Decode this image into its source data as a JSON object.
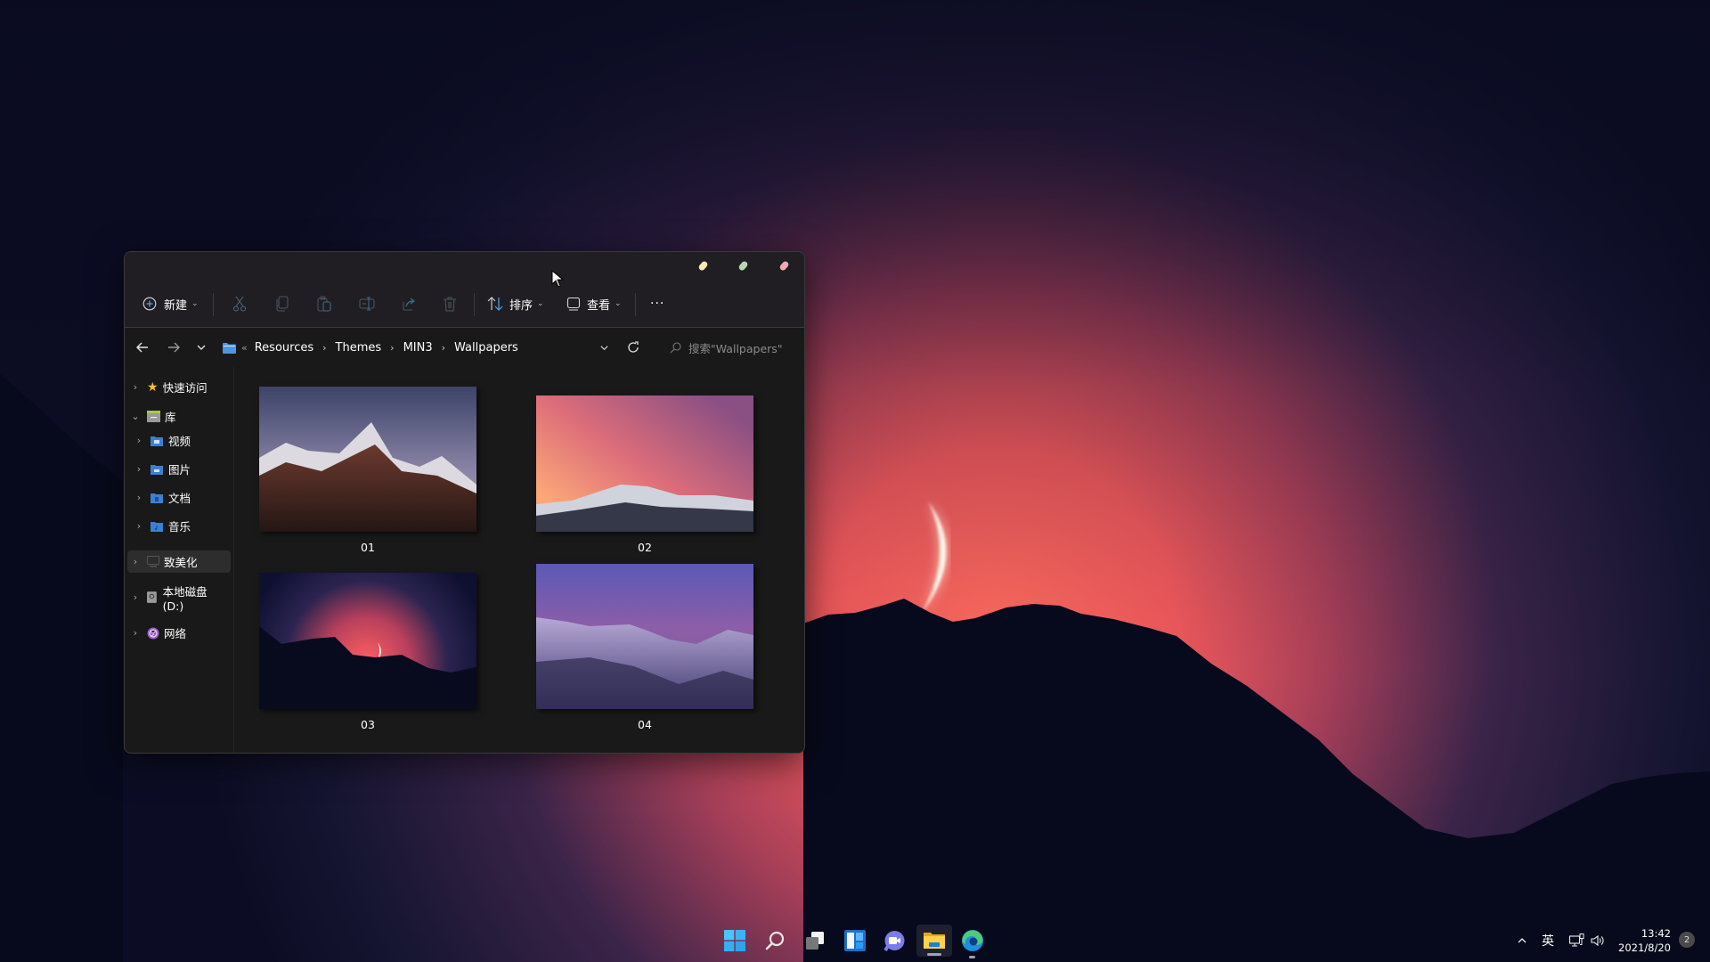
{
  "desktop": {
    "wallpaper": "crescent-moon-over-mountain-silhouette",
    "colors": {
      "sky_top": "#0b0d22",
      "glow": "#f8625e",
      "mountain": "#070a1c",
      "moon": "#fff3e6"
    }
  },
  "window": {
    "title_dots": [
      {
        "name": "minimize",
        "color": "#fde7b3"
      },
      {
        "name": "maximize",
        "color": "#b7d6b0"
      },
      {
        "name": "close",
        "color": "#f4a7b4"
      }
    ],
    "toolbar": {
      "new_label": "新建",
      "sort_label": "排序",
      "view_label": "查看",
      "more_label": "···",
      "icons": [
        "plus-circle-icon",
        "cut-icon",
        "copy-icon",
        "paste-icon",
        "rename-icon",
        "share-icon",
        "delete-icon",
        "sort-icon",
        "view-icon"
      ]
    },
    "address": {
      "overflow": "«",
      "breadcrumbs": [
        "Resources",
        "Themes",
        "MIN3",
        "Wallpapers"
      ],
      "search_placeholder": "搜索\"Wallpapers\""
    },
    "sidebar": {
      "items": [
        {
          "label": "快速访问",
          "icon": "star-icon",
          "expanded": false,
          "level": 0
        },
        {
          "label": "库",
          "icon": "library-icon",
          "expanded": true,
          "level": 0
        },
        {
          "label": "视频",
          "icon": "videos-folder-icon",
          "expanded": false,
          "level": 1
        },
        {
          "label": "图片",
          "icon": "pictures-folder-icon",
          "expanded": false,
          "level": 1
        },
        {
          "label": "文档",
          "icon": "documents-folder-icon",
          "expanded": false,
          "level": 1
        },
        {
          "label": "音乐",
          "icon": "music-folder-icon",
          "expanded": false,
          "level": 1
        },
        {
          "label": "致美化",
          "icon": "computer-icon",
          "expanded": false,
          "level": 0,
          "selected": true
        },
        {
          "label": "本地磁盘 (D:)",
          "icon": "drive-icon",
          "expanded": false,
          "level": 0
        },
        {
          "label": "网络",
          "icon": "network-icon",
          "expanded": false,
          "level": 0
        }
      ]
    },
    "files": [
      {
        "name": "01",
        "thumbnail": "snowy-peaks-at-dusk"
      },
      {
        "name": "02",
        "thumbnail": "pink-sky-over-snowy-range"
      },
      {
        "name": "03",
        "thumbnail": "crescent-moon-mountain-silhouette"
      },
      {
        "name": "04",
        "thumbnail": "purple-snowy-mountains"
      }
    ]
  },
  "taskbar": {
    "apps": [
      "start-icon",
      "search-icon",
      "task-view-icon",
      "widgets-icon",
      "chat-icon",
      "file-explorer-icon",
      "edge-icon"
    ],
    "active_app": "file-explorer-icon",
    "tray": {
      "input_method": "英",
      "time": "13:42",
      "date": "2021/8/20",
      "notifications": "2"
    }
  }
}
